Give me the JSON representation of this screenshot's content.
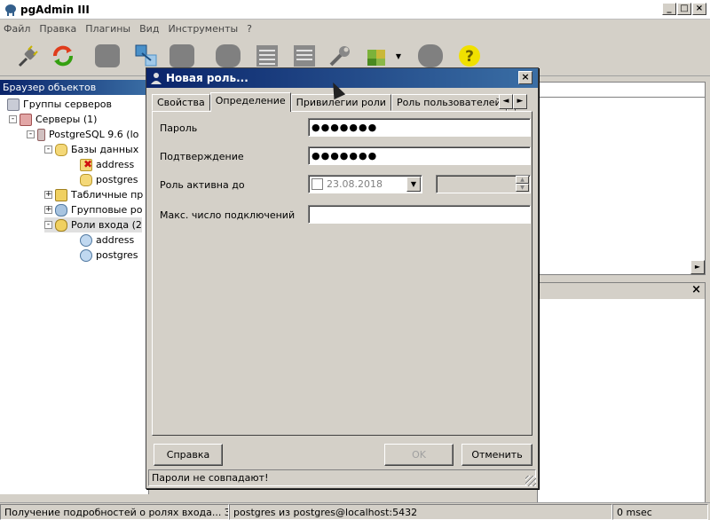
{
  "app": {
    "title": "pgAdmin III",
    "window_buttons": [
      "_",
      "□",
      "×"
    ]
  },
  "menu": [
    "Файл",
    "Правка",
    "Плагины",
    "Вид",
    "Инструменты",
    "?"
  ],
  "toolbar": {
    "icons": [
      "connect-icon",
      "refresh-icon",
      "object-icon",
      "properties-icon",
      "create-icon",
      "delete-icon",
      "sql-icon",
      "view-data-icon",
      "filter-data-icon",
      "maintenance-icon",
      "plugins-icon",
      "hint-icon",
      "help-icon"
    ]
  },
  "browser": {
    "header": "Браузер объектов",
    "tree": [
      {
        "label": "Группы серверов",
        "icon": "server-group-icon",
        "level": 0,
        "expander": ""
      },
      {
        "label": "Серверы (1)",
        "icon": "servers-icon",
        "level": 1,
        "expander": "-"
      },
      {
        "label": "PostgreSQL 9.6 (lo",
        "icon": "server-icon",
        "level": 2,
        "expander": "-"
      },
      {
        "label": "Базы данных",
        "icon": "databases-icon",
        "level": 3,
        "expander": "-"
      },
      {
        "label": "address",
        "icon": "database-disconnected-icon",
        "level": 4,
        "expander": ""
      },
      {
        "label": "postgres",
        "icon": "database-icon",
        "level": 4,
        "expander": ""
      },
      {
        "label": "Табличные пр",
        "icon": "tablespaces-icon",
        "level": 3,
        "expander": "+"
      },
      {
        "label": "Групповые ро",
        "icon": "group-roles-icon",
        "level": 3,
        "expander": "+"
      },
      {
        "label": "Роли входа (2",
        "icon": "login-roles-icon",
        "level": 3,
        "expander": "-"
      },
      {
        "label": "address",
        "icon": "user-icon",
        "level": 4,
        "expander": ""
      },
      {
        "label": "postgres",
        "icon": "user-icon",
        "level": 4,
        "expander": ""
      }
    ]
  },
  "dialog": {
    "title": "Новая роль...",
    "close": "×",
    "tabs": [
      "Свойства",
      "Определение",
      "Привилегии роли",
      "Роль пользователей",
      "|"
    ],
    "active_tab": "Определение",
    "tab_scroll": [
      "◄",
      "►"
    ],
    "fields": {
      "password_label": "Пароль",
      "password_value": "●●●●●●●",
      "confirm_label": "Подтверждение",
      "confirm_value": "●●●●●●●",
      "expires_label": "Роль активна до",
      "expires_date": "23.08.2018",
      "expires_drop": "▼",
      "spin_up": "▲",
      "spin_down": "▼",
      "maxconn_label": "Макс. число подключений",
      "maxconn_value": ""
    },
    "buttons": {
      "help": "Справка",
      "ok": "OK",
      "cancel": "Отменить"
    },
    "status": "Пароли не совпадают!"
  },
  "right_panel": {
    "close": "×"
  },
  "statusbar": {
    "left": "Получение подробностей о ролях входа... За",
    "middle": "postgres из postgres@localhost:5432",
    "right": "0 msec"
  }
}
